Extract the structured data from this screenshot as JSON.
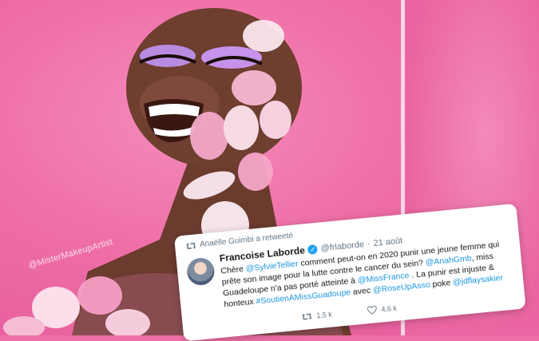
{
  "photo": {
    "watermark": "@MisterMakeupArtist"
  },
  "tweet": {
    "retweet_label": "Anaëlle Guimbi a retweeté",
    "author_name": "Francoise Laborde",
    "handle": "@frlaborde",
    "date": "21 août",
    "lines": [
      [
        "Chère ",
        "@SylvieTellier",
        " comment peut-on en 2020 punir une jeune femme qui"
      ],
      [
        "prête son image pour la lutte contre le cancer du sein? ",
        "@AnahGmb",
        ", miss"
      ],
      [
        "Guadeloupe n'a pas porté atteinte à ",
        "@MissFrance",
        " . La punir est injuste &"
      ],
      [
        "honteux ",
        "#SoutienAMissGuadoupe",
        " avec ",
        "@RoseUpAsso",
        " poke ",
        "@jdflaysakier"
      ]
    ],
    "retweets": "1,5 k",
    "likes": "4,6 k"
  },
  "colors": {
    "background_pink": "#ee6fa6",
    "link_blue": "#1b95e0",
    "verified_blue": "#1da1f2"
  }
}
